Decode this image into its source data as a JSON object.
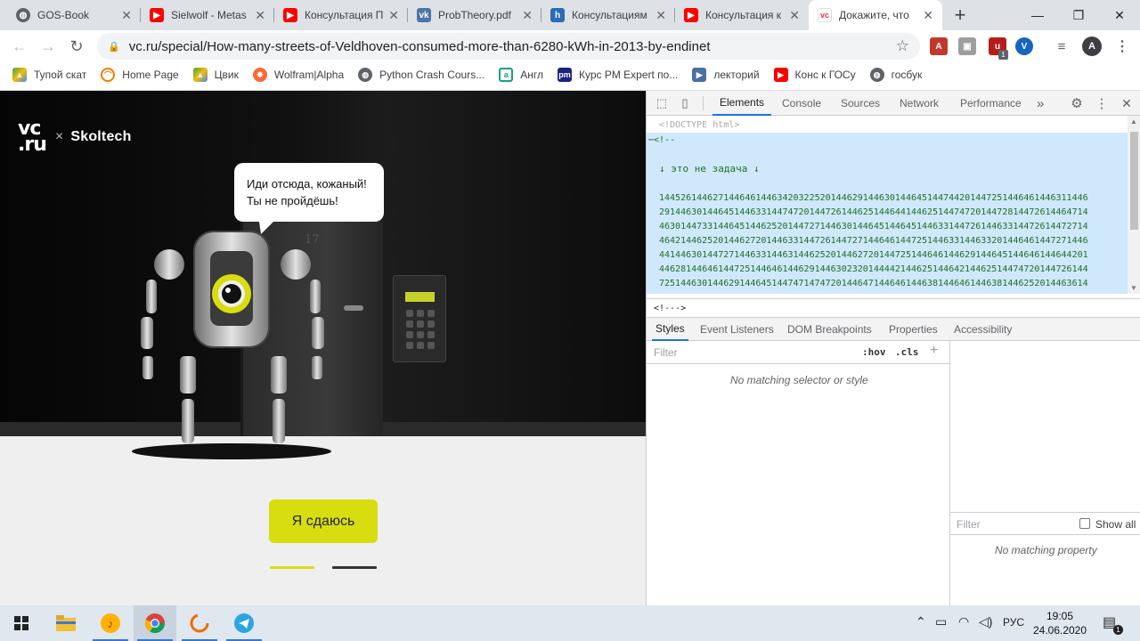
{
  "tabs": [
    {
      "label": "GOS-Book",
      "icon": "globe-icon"
    },
    {
      "label": "Sielwolf - Metas",
      "icon": "youtube-icon"
    },
    {
      "label": "Консультация П",
      "icon": "youtube-icon"
    },
    {
      "label": "ProbTheory.pdf",
      "icon": "vk-icon"
    },
    {
      "label": "Консультациям",
      "icon": "h-icon"
    },
    {
      "label": "Консультация к",
      "icon": "youtube-icon"
    },
    {
      "label": "Докажите, что",
      "icon": "vc-icon"
    }
  ],
  "new_tab": "+",
  "address": {
    "url": "vc.ru/special/How-many-streets-of-Veldhoven-consumed-more-than-6280-kWh-in-2013-by-endinet"
  },
  "profile_initial": "A",
  "extension_badge": "1",
  "bookmarks": [
    {
      "label": "Тупой скат",
      "icon": "drive-icon"
    },
    {
      "label": "Home Page",
      "icon": "home-page-icon"
    },
    {
      "label": "Цвик",
      "icon": "drive-icon"
    },
    {
      "label": "Wolfram|Alpha",
      "icon": "wolfram-icon"
    },
    {
      "label": "Python Crash Cours...",
      "icon": "globe-icon"
    },
    {
      "label": "Англ",
      "icon": "dictionary-icon"
    },
    {
      "label": "Курс PM Expert по...",
      "icon": "pm-expert-icon"
    },
    {
      "label": "лекторий",
      "icon": "lectorium-icon"
    },
    {
      "label": "Конс к ГОСу",
      "icon": "youtube-icon"
    },
    {
      "label": "госбук",
      "icon": "globe-icon"
    }
  ],
  "page": {
    "logo_vc_top": "vc",
    "logo_vc_bottom": ".ru",
    "logo_x": "×",
    "logo_skoltech": "Skoltech",
    "bubble_line1": "Иди отсюда, кожаный!",
    "bubble_line2": "Ты не пройдёшь!",
    "door_number": "17",
    "giveup_button": "Я сдаюсь",
    "accent_color": "#d8dd10",
    "pager_active_step": 1,
    "pager_total_steps": 2
  },
  "devtools": {
    "tabs": [
      "Elements",
      "Console",
      "Sources",
      "Network",
      "Performance"
    ],
    "more_tabs": "»",
    "doctype": "<!DOCTYPE html>",
    "comment_open": "<!--",
    "task_line": "↓ это не задача ↓",
    "digits": "1445261446271446461446342032252014462914463014464514474420144725144646144631144629144630144645144633144747201447261446251446441446251447472014472814472614464714463014473314464514462520144727144630144645144645144633144726144633144726144727144642144625201446272014463314472614472714464614472514463314463320144646144727144644144630144727144633144631446252014462720144725144646144629144645144646144644201446281446461447251446461446291446302320144442144625144642144625144747201447261447251446301446291446451447471474720144647144646144638144646144638144625201446361447431446431446252014",
    "comment_close": "<!--->",
    "styles_tabs": [
      "Styles",
      "Event Listeners",
      "DOM Breakpoints",
      "Properties",
      "Accessibility"
    ],
    "styles_filter_placeholder": "Filter",
    "hov": ":hov",
    "cls": ".cls",
    "no_matching_style": "No matching selector or style",
    "computed_filter_placeholder": "Filter",
    "show_all": "Show all",
    "no_matching_property": "No matching property"
  },
  "taskbar": {
    "apps": [
      "start-icon",
      "file-explorer-icon",
      "music-app-icon",
      "chrome-icon",
      "timer-icon",
      "telegram-icon"
    ],
    "language": "РУС",
    "time": "19:05",
    "date": "24.06.2020",
    "notification_count": "1"
  }
}
